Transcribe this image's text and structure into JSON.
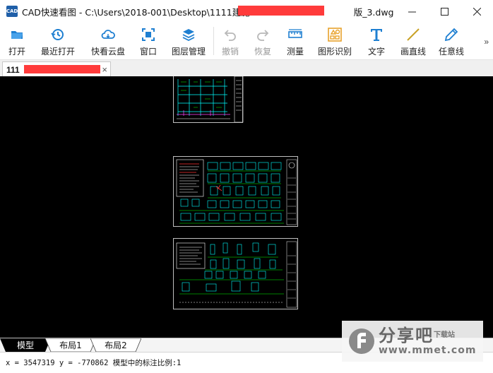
{
  "window": {
    "app_icon_text": "CAD",
    "title": "CAD快速看图 - C:\\Users\\2018-001\\Desktop\\1111建施-一",
    "title_suffix": "版_3.dwg"
  },
  "toolbar": {
    "items": [
      {
        "label": "打开",
        "icon": "folder-open-icon"
      },
      {
        "label": "最近打开",
        "icon": "history-icon"
      },
      {
        "label": "快看云盘",
        "icon": "cloud-icon"
      },
      {
        "label": "窗口",
        "icon": "window-target-icon"
      },
      {
        "label": "图层管理",
        "icon": "layers-icon"
      },
      {
        "label": "撤销",
        "icon": "undo-icon",
        "disabled": true
      },
      {
        "label": "恢复",
        "icon": "redo-icon",
        "disabled": true
      },
      {
        "label": "测量",
        "icon": "ruler-icon"
      },
      {
        "label": "图形识别",
        "icon": "shape-recognize-icon"
      },
      {
        "label": "文字",
        "icon": "text-icon"
      },
      {
        "label": "画直线",
        "icon": "line-icon"
      },
      {
        "label": "任意线",
        "icon": "pen-icon"
      }
    ],
    "more": "»"
  },
  "document_tab": {
    "name": "111",
    "close": "×"
  },
  "layout_tabs": [
    "模型",
    "布局1",
    "布局2"
  ],
  "status": {
    "text": "x = 3547319 y = -770862 模型中的标注比例:1"
  },
  "watermark": {
    "brand": "分享吧",
    "sub": "下载站",
    "url": "www.mmet.com"
  },
  "colors": {
    "accent": "#1e7fd1",
    "canvas_bg": "#000000",
    "redaction": "#ff3b3b",
    "drawing_cyan": "#00ffff",
    "drawing_green": "#00ff00"
  }
}
